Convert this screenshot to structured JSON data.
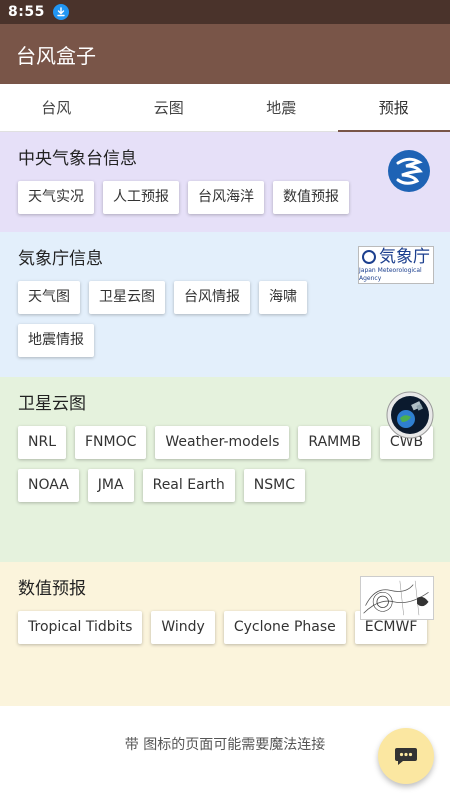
{
  "status_bar": {
    "time": "8:55"
  },
  "app_bar": {
    "title": "台风盒子"
  },
  "tabs": [
    {
      "label": "台风",
      "active": false
    },
    {
      "label": "云图",
      "active": false
    },
    {
      "label": "地震",
      "active": false
    },
    {
      "label": "预报",
      "active": true
    }
  ],
  "sections": [
    {
      "title": "中央气象台信息",
      "color": "#e6e0f8",
      "items": [
        "天气实况",
        "人工预报",
        "台风海洋",
        "数值预报"
      ]
    },
    {
      "title": "気象庁信息",
      "color": "#e3effb",
      "logo_text": "気象庁",
      "logo_subtext": "Japan Meteorological Agency",
      "items": [
        "天气图",
        "卫星云图",
        "台风情报",
        "海啸",
        "地震情报"
      ]
    },
    {
      "title": "卫星云图",
      "color": "#e5f2dd",
      "items": [
        "NRL ",
        "FNMOC ",
        "Weather-models",
        "RAMMB",
        "CWB",
        "NOAA",
        "JMA",
        "Real Earth",
        "NSMC"
      ]
    },
    {
      "title": "数值预报",
      "color": "#fbf4dc",
      "items": [
        "Tropical Tidbits",
        "Windy",
        "Cyclone Phase",
        "ECMWF"
      ]
    }
  ],
  "footer_note": "带  图标的页面可能需要魔法连接",
  "colors": {
    "primary": "#795548",
    "primary_dark": "#4a332b",
    "fab": "#fbe7a1"
  },
  "icons": {
    "download": "download-icon",
    "fab": "chat-bubble-icon",
    "cma_logo": "cma-logo-icon",
    "satellite_logo": "satellite-logo-icon",
    "nwp_thumbnail": "nwp-map-thumbnail"
  }
}
